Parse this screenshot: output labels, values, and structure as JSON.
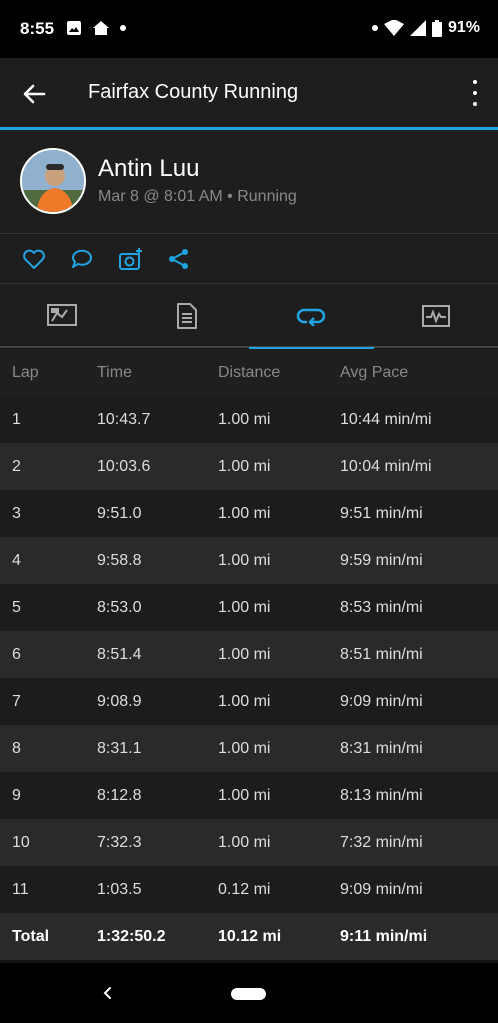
{
  "status_bar": {
    "time": "8:55",
    "battery": "91%"
  },
  "app_bar": {
    "title": "Fairfax County Running"
  },
  "activity": {
    "user_name": "Antin Luu",
    "meta": "Mar 8 @ 8:01 AM • Running"
  },
  "table": {
    "headers": [
      "Lap",
      "Time",
      "Distance",
      "Avg Pace"
    ],
    "rows": [
      [
        "1",
        "10:43.7",
        "1.00 mi",
        "10:44 min/mi"
      ],
      [
        "2",
        "10:03.6",
        "1.00 mi",
        "10:04 min/mi"
      ],
      [
        "3",
        "9:51.0",
        "1.00 mi",
        "9:51 min/mi"
      ],
      [
        "4",
        "9:58.8",
        "1.00 mi",
        "9:59 min/mi"
      ],
      [
        "5",
        "8:53.0",
        "1.00 mi",
        "8:53 min/mi"
      ],
      [
        "6",
        "8:51.4",
        "1.00 mi",
        "8:51 min/mi"
      ],
      [
        "7",
        "9:08.9",
        "1.00 mi",
        "9:09 min/mi"
      ],
      [
        "8",
        "8:31.1",
        "1.00 mi",
        "8:31 min/mi"
      ],
      [
        "9",
        "8:12.8",
        "1.00 mi",
        "8:13 min/mi"
      ],
      [
        "10",
        "7:32.3",
        "1.00 mi",
        "7:32 min/mi"
      ],
      [
        "11",
        "1:03.5",
        "0.12 mi",
        "9:09 min/mi"
      ]
    ],
    "total": [
      "Total",
      "1:32:50.2",
      "10.12 mi",
      "9:11 min/mi"
    ]
  },
  "colors": {
    "accent": "#1fa3e1",
    "background": "#121212"
  },
  "icons": {
    "status_left": [
      "image-icon",
      "home-icon"
    ],
    "actions": [
      "heart-icon",
      "comment-icon",
      "add-photo-icon",
      "share-icon"
    ],
    "tabs": [
      "map-tab-icon",
      "details-tab-icon",
      "laps-tab-icon",
      "chart-tab-icon"
    ]
  }
}
